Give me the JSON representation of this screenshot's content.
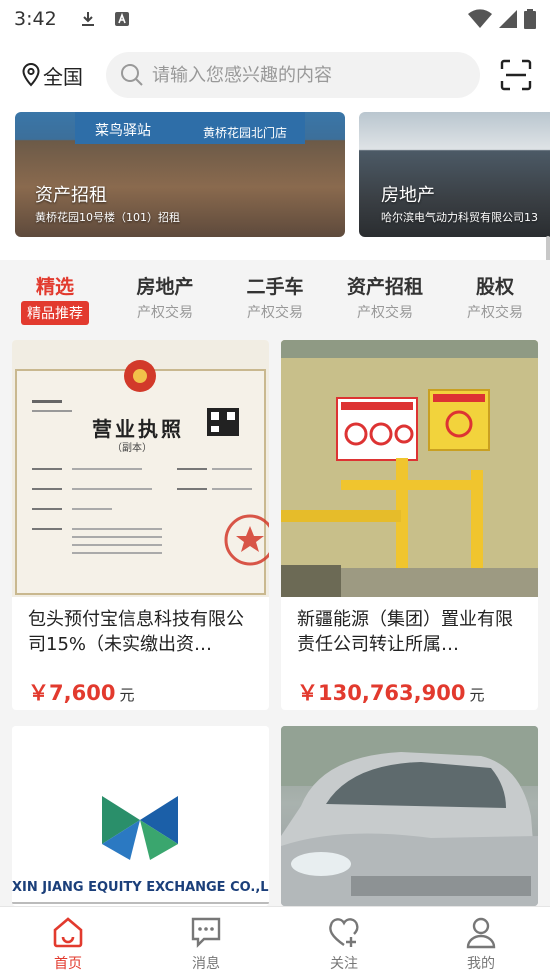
{
  "status_bar": {
    "time": "3:42"
  },
  "header": {
    "location_label": "全国",
    "search_placeholder": "请输入您感兴趣的内容"
  },
  "banners": [
    {
      "category": "资产招租",
      "subtitle": "黄桥花园10号楼（101）招租",
      "sign_brand": "菜鸟驿站",
      "sign_text": "黄桥花园北门店"
    },
    {
      "category": "房地产",
      "subtitle": "哈尔滨电气动力科贸有限公司13"
    }
  ],
  "tabs": [
    {
      "title": "精选",
      "subtitle": "精品推荐",
      "active": true
    },
    {
      "title": "房地产",
      "subtitle": "产权交易"
    },
    {
      "title": "二手车",
      "subtitle": "产权交易"
    },
    {
      "title": "资产招租",
      "subtitle": "产权交易"
    },
    {
      "title": "股权",
      "subtitle": "产权交易"
    }
  ],
  "products": [
    {
      "title": "包头预付宝信息科技有限公司15%（未实缴出资…",
      "price": "￥7,600",
      "unit": "元",
      "image": "business-license"
    },
    {
      "title": "新疆能源（集团）置业有限责任公司转让所属…",
      "price": "￥130,763,900",
      "unit": "元",
      "image": "gas-pipes-wall"
    },
    {
      "title": "",
      "price": "",
      "unit": "",
      "image": "exchange-logo",
      "logo_text": "XIN JIANG EQUITY EXCHANGE CO.,L"
    },
    {
      "title": "",
      "price": "",
      "unit": "",
      "image": "silver-suv"
    }
  ],
  "cert": {
    "title": "营业执照",
    "subtitle": "（副本）"
  },
  "bottom_nav": [
    {
      "label": "首页",
      "icon": "home-icon",
      "active": true
    },
    {
      "label": "消息",
      "icon": "message-icon"
    },
    {
      "label": "关注",
      "icon": "heart-plus-icon"
    },
    {
      "label": "我的",
      "icon": "user-icon"
    }
  ],
  "colors": {
    "accent": "#e23a2e",
    "background": "#f4f4f4"
  }
}
